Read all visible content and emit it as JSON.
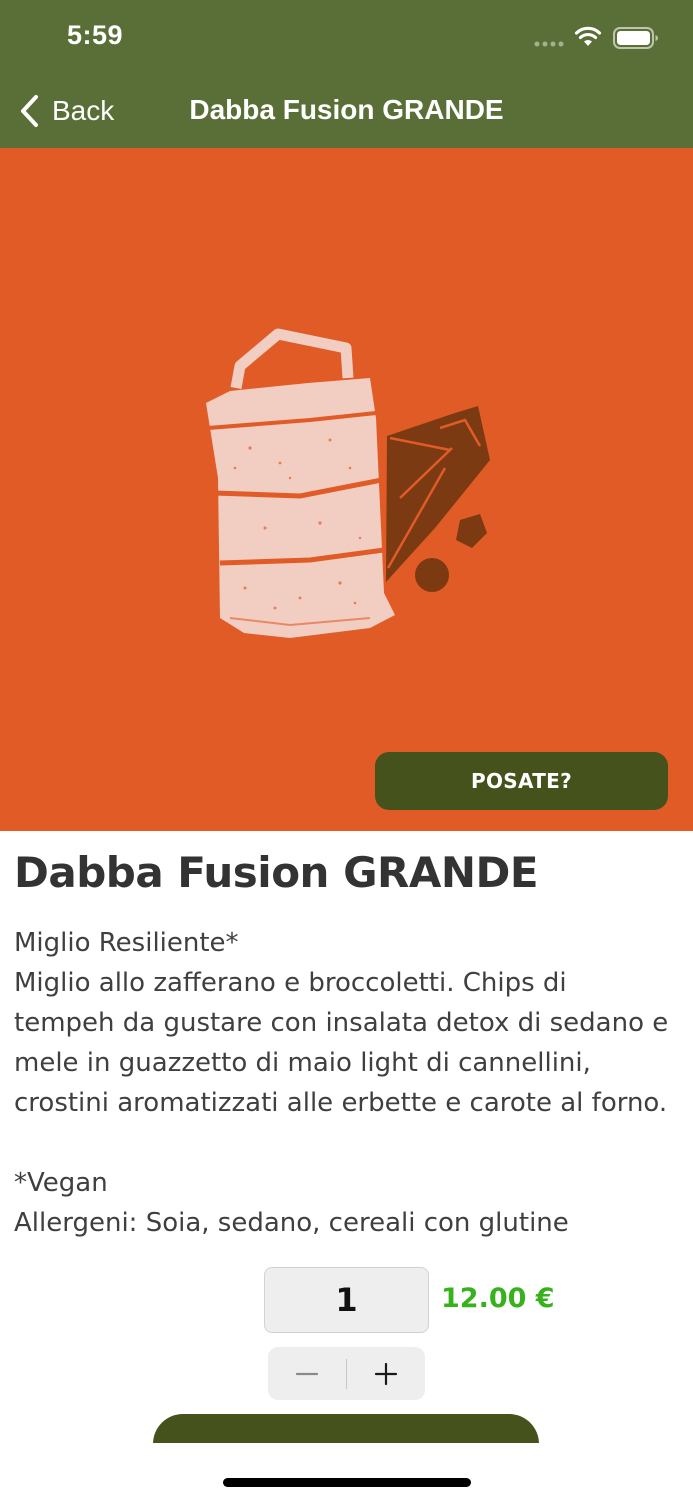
{
  "status_bar": {
    "time": "5:59"
  },
  "nav": {
    "back_label": "Back",
    "title": "Dabba Fusion GRANDE"
  },
  "hero": {
    "background": "#e15b26",
    "posate_label": "POSATE?"
  },
  "product": {
    "title": "Dabba Fusion GRANDE",
    "description_lines": [
      "Miglio Resiliente*",
      "Miglio allo zafferano e broccoletti. Chips di",
      "tempeh da gustare con insalata detox di sedano e",
      "mele in guazzetto di maio light di cannellini,",
      "crostini aromatizzati alle erbette e carote al forno."
    ],
    "note_lines": [
      "*Vegan",
      "Allergeni: Soia, sedano, cereali con glutine"
    ]
  },
  "order": {
    "quantity": "1",
    "price": "12.00 €",
    "price_color": "#38b21c"
  },
  "colors": {
    "header": "#5a6f37",
    "button": "#45521b"
  },
  "icons": {
    "back": "chevron-left-icon",
    "minus": "minus-icon",
    "plus": "plus-icon"
  }
}
